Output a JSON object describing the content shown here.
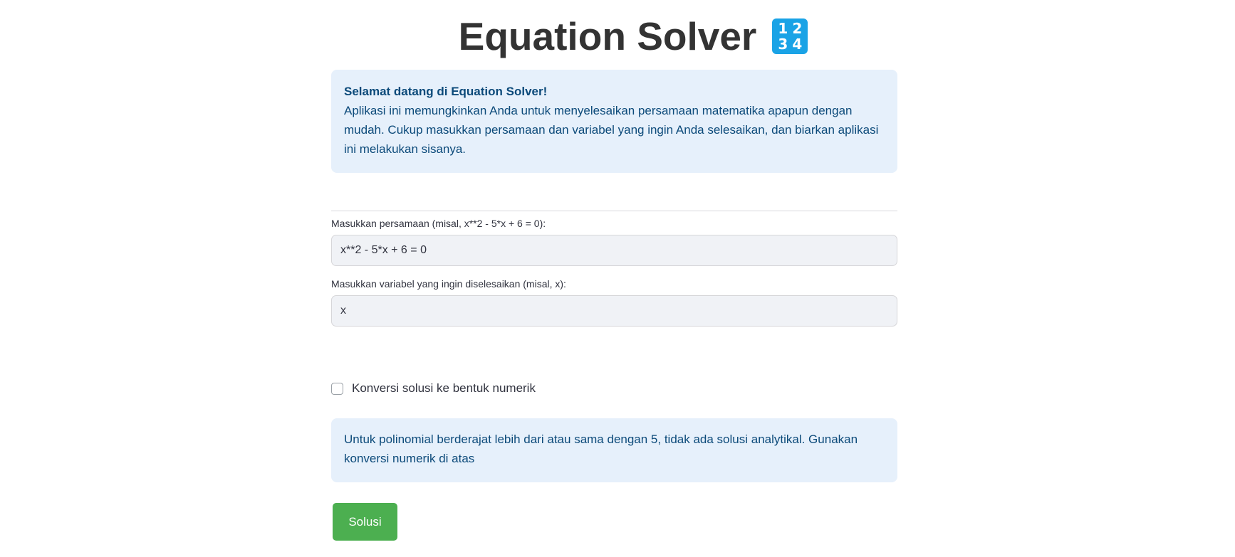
{
  "header": {
    "title": "Equation Solver",
    "emoji_digits": [
      "1",
      "2",
      "3",
      "4"
    ],
    "emoji_icon": "keycap-1234-icon"
  },
  "welcome": {
    "heading": "Selamat datang di Equation Solver!",
    "body": "Aplikasi ini memungkinkan Anda untuk menyelesaikan persamaan matematika apapun dengan mudah. Cukup masukkan persamaan dan variabel yang ingin Anda selesaikan, dan biarkan aplikasi ini melakukan sisanya."
  },
  "form": {
    "equation_label": "Masukkan persamaan (misal, x**2 - 5*x + 6 = 0):",
    "equation_value": "x**2 - 5*x + 6 = 0",
    "variable_label": "Masukkan variabel yang ingin diselesaikan (misal, x):",
    "variable_value": "x",
    "numeric_checkbox_label": "Konversi solusi ke bentuk numerik",
    "numeric_checkbox_checked": false
  },
  "note": {
    "text": "Untuk polinomial berderajat lebih dari atau sama dengan 5, tidak ada solusi analytikal. Gunakan konversi numerik di atas"
  },
  "actions": {
    "solve_label": "Solusi"
  },
  "colors": {
    "info_background": "#e6f0fb",
    "info_text": "#0c4a7a",
    "button_green": "#4caf50",
    "emoji_blue": "#1aa3e6"
  }
}
